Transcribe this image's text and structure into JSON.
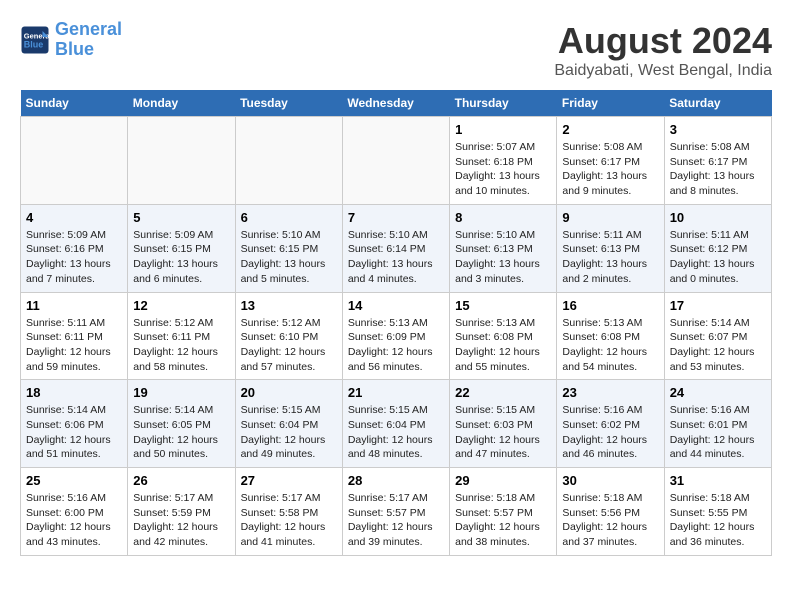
{
  "header": {
    "logo_line1": "General",
    "logo_line2": "Blue",
    "title": "August 2024",
    "subtitle": "Baidyabati, West Bengal, India"
  },
  "days_of_week": [
    "Sunday",
    "Monday",
    "Tuesday",
    "Wednesday",
    "Thursday",
    "Friday",
    "Saturday"
  ],
  "weeks": [
    [
      {
        "day": "",
        "info": ""
      },
      {
        "day": "",
        "info": ""
      },
      {
        "day": "",
        "info": ""
      },
      {
        "day": "",
        "info": ""
      },
      {
        "day": "1",
        "info": "Sunrise: 5:07 AM\nSunset: 6:18 PM\nDaylight: 13 hours\nand 10 minutes."
      },
      {
        "day": "2",
        "info": "Sunrise: 5:08 AM\nSunset: 6:17 PM\nDaylight: 13 hours\nand 9 minutes."
      },
      {
        "day": "3",
        "info": "Sunrise: 5:08 AM\nSunset: 6:17 PM\nDaylight: 13 hours\nand 8 minutes."
      }
    ],
    [
      {
        "day": "4",
        "info": "Sunrise: 5:09 AM\nSunset: 6:16 PM\nDaylight: 13 hours\nand 7 minutes."
      },
      {
        "day": "5",
        "info": "Sunrise: 5:09 AM\nSunset: 6:15 PM\nDaylight: 13 hours\nand 6 minutes."
      },
      {
        "day": "6",
        "info": "Sunrise: 5:10 AM\nSunset: 6:15 PM\nDaylight: 13 hours\nand 5 minutes."
      },
      {
        "day": "7",
        "info": "Sunrise: 5:10 AM\nSunset: 6:14 PM\nDaylight: 13 hours\nand 4 minutes."
      },
      {
        "day": "8",
        "info": "Sunrise: 5:10 AM\nSunset: 6:13 PM\nDaylight: 13 hours\nand 3 minutes."
      },
      {
        "day": "9",
        "info": "Sunrise: 5:11 AM\nSunset: 6:13 PM\nDaylight: 13 hours\nand 2 minutes."
      },
      {
        "day": "10",
        "info": "Sunrise: 5:11 AM\nSunset: 6:12 PM\nDaylight: 13 hours\nand 0 minutes."
      }
    ],
    [
      {
        "day": "11",
        "info": "Sunrise: 5:11 AM\nSunset: 6:11 PM\nDaylight: 12 hours\nand 59 minutes."
      },
      {
        "day": "12",
        "info": "Sunrise: 5:12 AM\nSunset: 6:11 PM\nDaylight: 12 hours\nand 58 minutes."
      },
      {
        "day": "13",
        "info": "Sunrise: 5:12 AM\nSunset: 6:10 PM\nDaylight: 12 hours\nand 57 minutes."
      },
      {
        "day": "14",
        "info": "Sunrise: 5:13 AM\nSunset: 6:09 PM\nDaylight: 12 hours\nand 56 minutes."
      },
      {
        "day": "15",
        "info": "Sunrise: 5:13 AM\nSunset: 6:08 PM\nDaylight: 12 hours\nand 55 minutes."
      },
      {
        "day": "16",
        "info": "Sunrise: 5:13 AM\nSunset: 6:08 PM\nDaylight: 12 hours\nand 54 minutes."
      },
      {
        "day": "17",
        "info": "Sunrise: 5:14 AM\nSunset: 6:07 PM\nDaylight: 12 hours\nand 53 minutes."
      }
    ],
    [
      {
        "day": "18",
        "info": "Sunrise: 5:14 AM\nSunset: 6:06 PM\nDaylight: 12 hours\nand 51 minutes."
      },
      {
        "day": "19",
        "info": "Sunrise: 5:14 AM\nSunset: 6:05 PM\nDaylight: 12 hours\nand 50 minutes."
      },
      {
        "day": "20",
        "info": "Sunrise: 5:15 AM\nSunset: 6:04 PM\nDaylight: 12 hours\nand 49 minutes."
      },
      {
        "day": "21",
        "info": "Sunrise: 5:15 AM\nSunset: 6:04 PM\nDaylight: 12 hours\nand 48 minutes."
      },
      {
        "day": "22",
        "info": "Sunrise: 5:15 AM\nSunset: 6:03 PM\nDaylight: 12 hours\nand 47 minutes."
      },
      {
        "day": "23",
        "info": "Sunrise: 5:16 AM\nSunset: 6:02 PM\nDaylight: 12 hours\nand 46 minutes."
      },
      {
        "day": "24",
        "info": "Sunrise: 5:16 AM\nSunset: 6:01 PM\nDaylight: 12 hours\nand 44 minutes."
      }
    ],
    [
      {
        "day": "25",
        "info": "Sunrise: 5:16 AM\nSunset: 6:00 PM\nDaylight: 12 hours\nand 43 minutes."
      },
      {
        "day": "26",
        "info": "Sunrise: 5:17 AM\nSunset: 5:59 PM\nDaylight: 12 hours\nand 42 minutes."
      },
      {
        "day": "27",
        "info": "Sunrise: 5:17 AM\nSunset: 5:58 PM\nDaylight: 12 hours\nand 41 minutes."
      },
      {
        "day": "28",
        "info": "Sunrise: 5:17 AM\nSunset: 5:57 PM\nDaylight: 12 hours\nand 39 minutes."
      },
      {
        "day": "29",
        "info": "Sunrise: 5:18 AM\nSunset: 5:57 PM\nDaylight: 12 hours\nand 38 minutes."
      },
      {
        "day": "30",
        "info": "Sunrise: 5:18 AM\nSunset: 5:56 PM\nDaylight: 12 hours\nand 37 minutes."
      },
      {
        "day": "31",
        "info": "Sunrise: 5:18 AM\nSunset: 5:55 PM\nDaylight: 12 hours\nand 36 minutes."
      }
    ]
  ]
}
